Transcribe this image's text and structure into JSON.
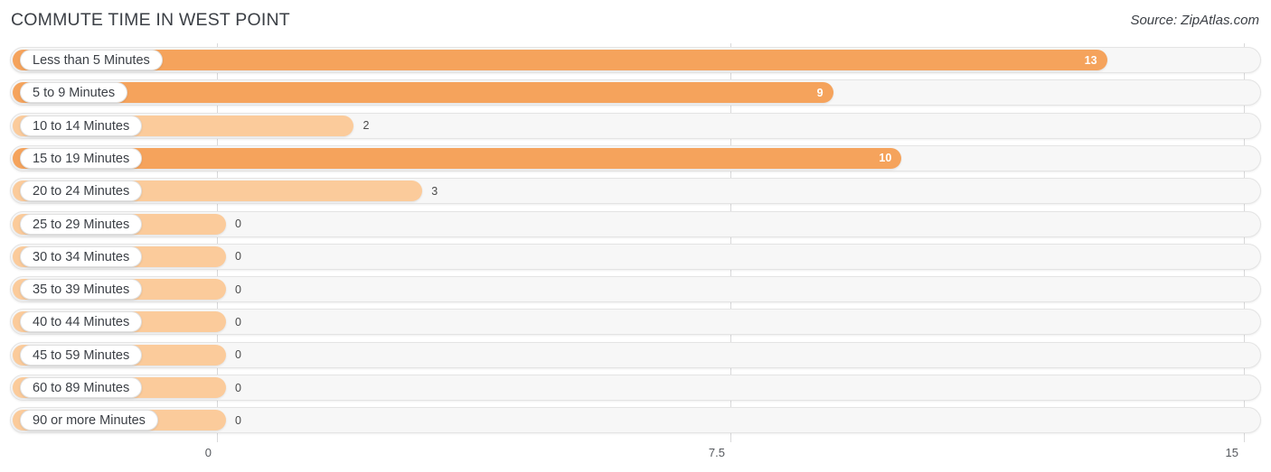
{
  "header": {
    "title": "COMMUTE TIME IN WEST POINT",
    "source": "Source: ZipAtlas.com"
  },
  "colors": {
    "bar_high": "#f5a35c",
    "bar_low": "#fbcb9b",
    "track_bg": "#f7f7f7",
    "track_border": "#e4e4e4",
    "gridline": "#d9d9da",
    "text": "#3b3f45"
  },
  "chart_data": {
    "type": "bar",
    "orientation": "horizontal",
    "title": "COMMUTE TIME IN WEST POINT",
    "xlabel": "",
    "ylabel": "",
    "xlim": [
      0,
      15
    ],
    "xticks": [
      "0",
      "7.5",
      "15"
    ],
    "xtick_values": [
      0,
      7.5,
      15
    ],
    "grid": true,
    "legend": false,
    "categories": [
      "Less than 5 Minutes",
      "5 to 9 Minutes",
      "10 to 14 Minutes",
      "15 to 19 Minutes",
      "20 to 24 Minutes",
      "25 to 29 Minutes",
      "30 to 34 Minutes",
      "35 to 39 Minutes",
      "40 to 44 Minutes",
      "45 to 59 Minutes",
      "60 to 89 Minutes",
      "90 or more Minutes"
    ],
    "values": [
      13,
      9,
      2,
      10,
      3,
      0,
      0,
      0,
      0,
      0,
      0,
      0
    ],
    "value_labels": [
      "13",
      "9",
      "2",
      "10",
      "3",
      "0",
      "0",
      "0",
      "0",
      "0",
      "0",
      "0"
    ]
  },
  "rows": [
    {
      "label": "Less than 5 Minutes",
      "value": 13,
      "value_label": "13",
      "tone": "high",
      "label_inside": true
    },
    {
      "label": "5 to 9 Minutes",
      "value": 9,
      "value_label": "9",
      "tone": "high",
      "label_inside": true
    },
    {
      "label": "10 to 14 Minutes",
      "value": 2,
      "value_label": "2",
      "tone": "low",
      "label_inside": false
    },
    {
      "label": "15 to 19 Minutes",
      "value": 10,
      "value_label": "10",
      "tone": "high",
      "label_inside": true
    },
    {
      "label": "20 to 24 Minutes",
      "value": 3,
      "value_label": "3",
      "tone": "low",
      "label_inside": false
    },
    {
      "label": "25 to 29 Minutes",
      "value": 0,
      "value_label": "0",
      "tone": "low",
      "label_inside": false
    },
    {
      "label": "30 to 34 Minutes",
      "value": 0,
      "value_label": "0",
      "tone": "low",
      "label_inside": false
    },
    {
      "label": "35 to 39 Minutes",
      "value": 0,
      "value_label": "0",
      "tone": "low",
      "label_inside": false
    },
    {
      "label": "40 to 44 Minutes",
      "value": 0,
      "value_label": "0",
      "tone": "low",
      "label_inside": false
    },
    {
      "label": "45 to 59 Minutes",
      "value": 0,
      "value_label": "0",
      "tone": "low",
      "label_inside": false
    },
    {
      "label": "60 to 89 Minutes",
      "value": 0,
      "value_label": "0",
      "tone": "low",
      "label_inside": false
    },
    {
      "label": "90 or more Minutes",
      "value": 0,
      "value_label": "0",
      "tone": "low",
      "label_inside": false
    }
  ],
  "axis": {
    "ticks": [
      {
        "label": "0",
        "value": 0
      },
      {
        "label": "7.5",
        "value": 7.5
      },
      {
        "label": "15",
        "value": 15
      }
    ]
  }
}
